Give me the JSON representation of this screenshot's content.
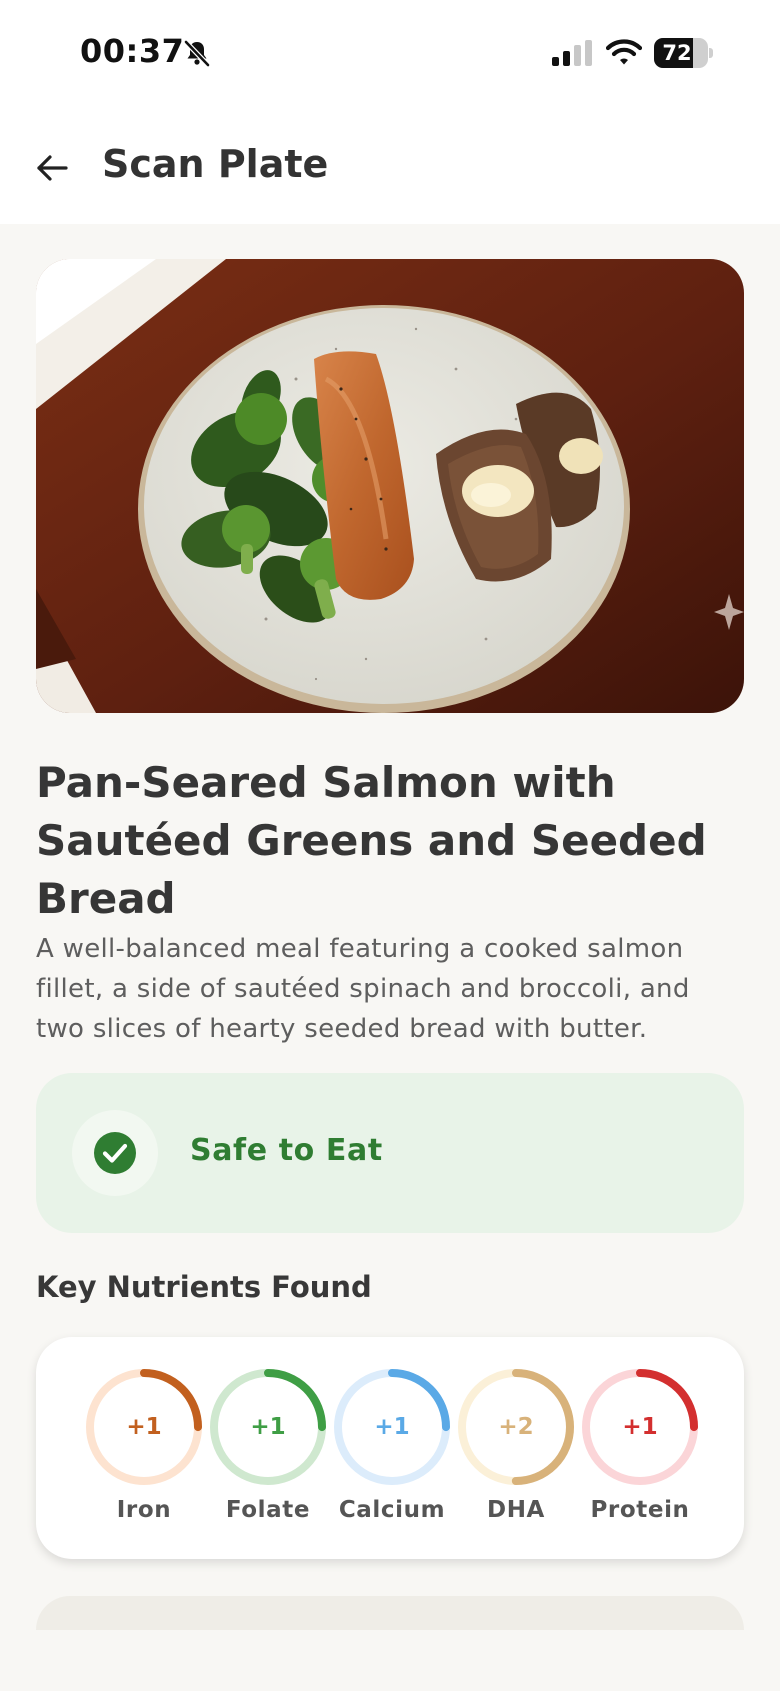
{
  "status_bar": {
    "time": "00:37",
    "battery_level": "72",
    "battery_fraction": 0.72
  },
  "header": {
    "title": "Scan Plate"
  },
  "meal": {
    "title": "Pan-Seared Salmon with Sautéed Greens and Seeded Bread",
    "description": "A well-balanced meal featuring a cooked salmon fillet, a side of sautéed spinach and broccoli, and two slices of hearty seeded bread with butter."
  },
  "safety": {
    "label": "Safe to Eat",
    "color": "#2f7d32"
  },
  "nutrients": {
    "section_title": "Key Nutrients Found",
    "items": [
      {
        "name": "Iron",
        "value": "+1",
        "color": "#c2601f",
        "track": "#fde3d0",
        "progress": 0.25
      },
      {
        "name": "Folate",
        "value": "+1",
        "color": "#3f9e45",
        "track": "#cfe8cf",
        "progress": 0.25
      },
      {
        "name": "Calcium",
        "value": "+1",
        "color": "#5aa9e6",
        "track": "#dcecfb",
        "progress": 0.25
      },
      {
        "name": "DHA",
        "value": "+2",
        "color": "#d8b27a",
        "track": "#fbf0d8",
        "progress": 0.5
      },
      {
        "name": "Protein",
        "value": "+1",
        "color": "#d32f2f",
        "track": "#fbd5d8",
        "progress": 0.25
      }
    ]
  },
  "icons": [
    "bell-slash-icon",
    "signal-icon",
    "wifi-icon",
    "battery-icon",
    "back-arrow-icon",
    "check-circle-icon",
    "sparkle-icon"
  ]
}
